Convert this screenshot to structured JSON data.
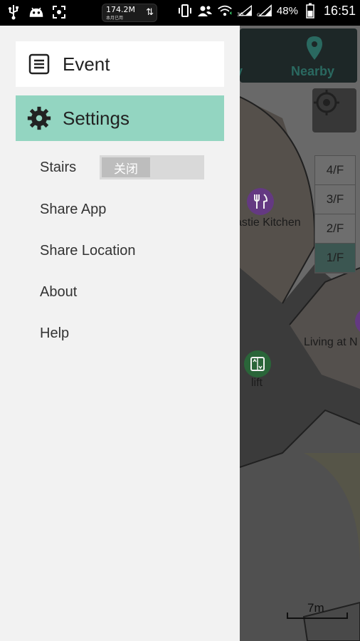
{
  "status_bar": {
    "net_speed": "174.2M",
    "net_sub": "本月已用",
    "battery": "48%",
    "time": "16:51",
    "icons": [
      "usb-icon",
      "android-icon",
      "screenshot-icon",
      "data-transfer-icon",
      "vibrate-icon",
      "contacts-icon",
      "wifi-icon",
      "signal-3g-icon",
      "signal-icon",
      "battery-icon"
    ]
  },
  "drawer": {
    "event_label": "Event",
    "settings_label": "Settings",
    "stairs_label": "Stairs",
    "stairs_toggle": "关闭",
    "share_app_label": "Share App",
    "share_location_label": "Share Location",
    "about_label": "About",
    "help_label": "Help",
    "accent_color": "#93d5c1"
  },
  "map": {
    "nav_partial_label": "y",
    "nearby_label": "Nearby",
    "floors": [
      "4/F",
      "3/F",
      "2/F",
      "1/F"
    ],
    "active_floor": "1/F",
    "poi_kitchen": "astie Kitchen",
    "poi_living": "Living at N",
    "poi_lift": "lift",
    "scale": "7m"
  }
}
